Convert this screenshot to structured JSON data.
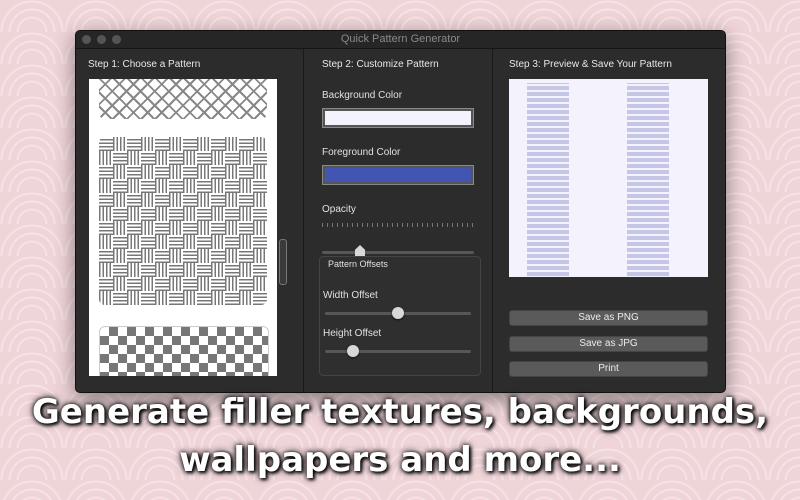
{
  "window": {
    "title": "Quick Pattern Generator"
  },
  "steps": {
    "choose": "Step 1: Choose a Pattern",
    "customize": "Step 2: Customize Pattern",
    "preview": "Step 3: Preview & Save Your Pattern"
  },
  "customize": {
    "background_label": "Background Color",
    "background_color": "#f3f2fd",
    "foreground_label": "Foreground Color",
    "foreground_color": "#4255b3",
    "opacity_label": "Opacity",
    "opacity_value": 0.25,
    "offsets_title": "Pattern Offsets",
    "width_offset_label": "Width Offset",
    "width_offset_value": 0.5,
    "height_offset_label": "Height Offset",
    "height_offset_value": 0.19
  },
  "patterns": [
    "diamond-lattice",
    "basket-weave",
    "checker-squares"
  ],
  "actions": {
    "save_png": "Save as PNG",
    "save_jpg": "Save as JPG",
    "print": "Print"
  },
  "caption": {
    "line1": "Generate filler textures, backgrounds,",
    "line2": "wallpapers and more..."
  },
  "colors": {
    "preview_mark": "#c5c6e6",
    "window_bg": "#2c2c2c"
  }
}
